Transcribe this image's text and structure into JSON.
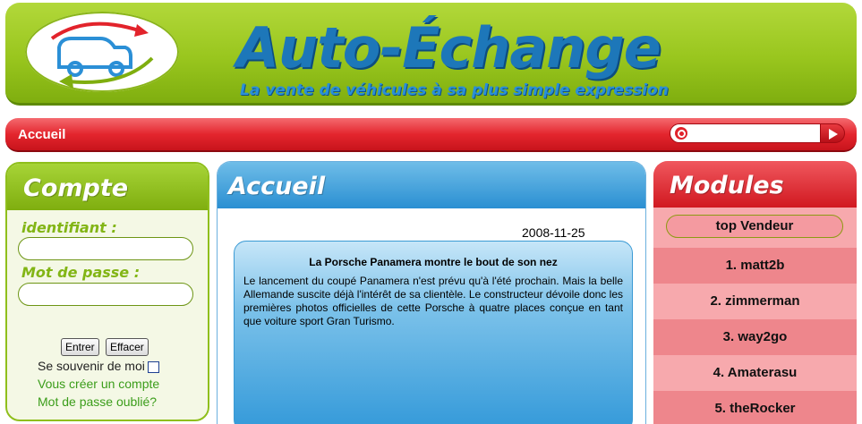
{
  "header": {
    "title": "Auto-Échange",
    "tagline": "La vente de véhicules à sa plus simple expression"
  },
  "nav": {
    "home_label": "Accueil",
    "search": {
      "placeholder": "",
      "value": ""
    }
  },
  "account": {
    "title": "Compte",
    "username_label": "identifiant :",
    "password_label": "Mot de passe :",
    "login_button": "Entrer",
    "clear_button": "Effacer",
    "remember_label": "Se souvenir de moi",
    "create_account_link": "Vous créer un compte",
    "forgot_password_link": "Mot de passe oublié?"
  },
  "main": {
    "title": "Accueil",
    "news": {
      "date": "2008-11-25",
      "headline": "La Porsche Panamera montre le bout de son nez",
      "body": "Le lancement du coupé Panamera n'est prévu qu'à l'été prochain. Mais la belle Allemande suscite déjà l'intérêt de sa clientèle. Le constructeur dévoile donc les premières photos officielles de cette Porsche à quatre places conçue en tant que voiture sport Gran Turismo."
    }
  },
  "modules": {
    "title": "Modules",
    "top_seller_label": "top Vendeur",
    "ranking": [
      "1. matt2b",
      "2. zimmerman",
      "3. way2go",
      "4. Amaterasu",
      "5. theRocker"
    ]
  },
  "colors": {
    "header_green": "#99c61e",
    "nav_red": "#e4262e",
    "main_blue": "#2a8fd2",
    "title_blue": "#1d77b9"
  }
}
